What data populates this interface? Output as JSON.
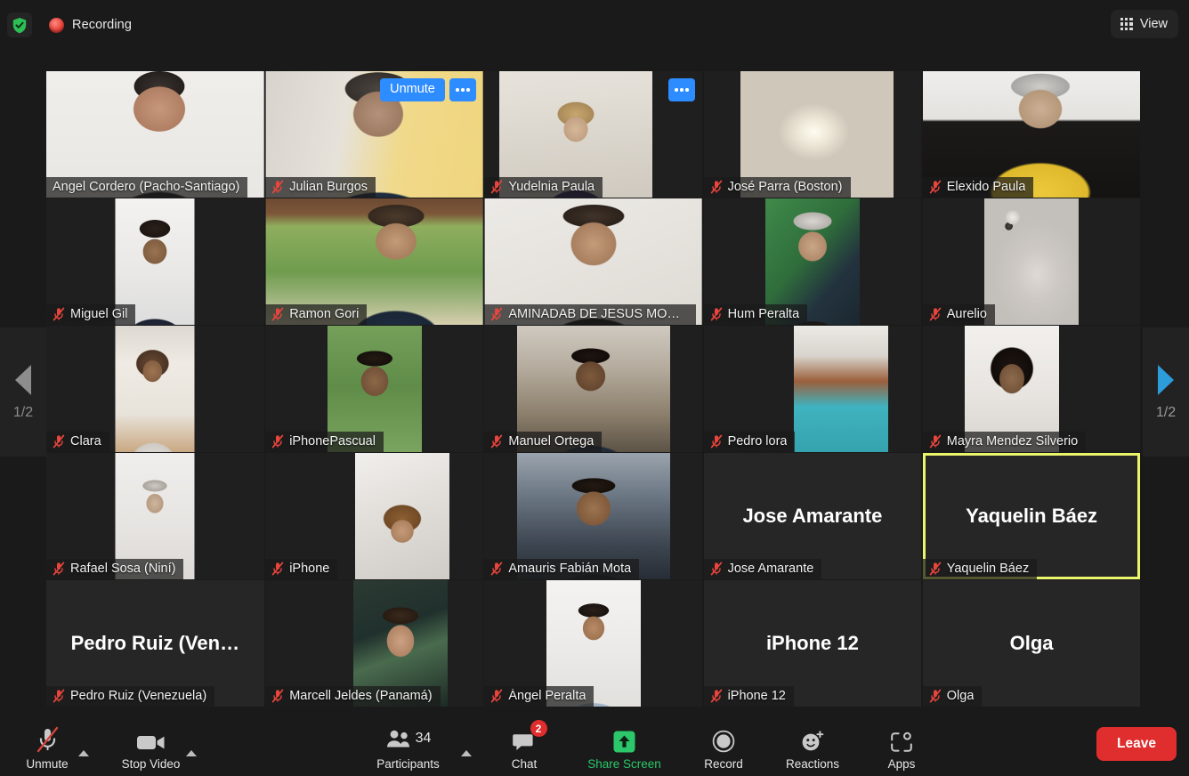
{
  "app": "Zoom Meeting",
  "topbar": {
    "shield_icon": "encryption-shield-icon",
    "recording_icon": "recording-indicator-icon",
    "recording_label": "Recording",
    "view_icon": "grid-view-icon",
    "view_label": "View"
  },
  "gallery": {
    "page_prev_label": "1/2",
    "page_next_label": "1/2",
    "prev_icon": "chevron-left-icon",
    "next_icon": "chevron-right-icon",
    "selected_participant": "Yaquelin Báez",
    "hover_tile": "Julian Burgos",
    "hover_unmute_label": "Unmute",
    "hover_more_label": "…",
    "rows": [
      [
        {
          "name": "Angel Cordero (Pacho-Santiago)",
          "muted": false,
          "video": true
        },
        {
          "name": "Julian Burgos",
          "muted": true,
          "video": true
        },
        {
          "name": "Yudelnia Paula",
          "muted": true,
          "video": true
        },
        {
          "name": "José Parra (Boston)",
          "muted": true,
          "video": true
        },
        {
          "name": "Elexido Paula",
          "muted": true,
          "video": true
        }
      ],
      [
        {
          "name": "Miguel Gil",
          "muted": true,
          "video": true
        },
        {
          "name": "Ramon Gori",
          "muted": true,
          "video": true
        },
        {
          "name": "AMINADAB DE JESUS MON…",
          "muted": true,
          "video": true
        },
        {
          "name": "Hum Peralta",
          "muted": true,
          "video": true
        },
        {
          "name": "Aurelio",
          "muted": true,
          "video": true
        }
      ],
      [
        {
          "name": "Clara",
          "muted": true,
          "video": true
        },
        {
          "name": "iPhonePascual",
          "muted": true,
          "video": true
        },
        {
          "name": "Manuel Ortega",
          "muted": true,
          "video": true
        },
        {
          "name": "Pedro lora",
          "muted": true,
          "video": true
        },
        {
          "name": "Mayra Mendez Silverio",
          "muted": true,
          "video": true
        }
      ],
      [
        {
          "name": "Rafael Sosa (Niní)",
          "muted": true,
          "video": true
        },
        {
          "name": "iPhone",
          "muted": true,
          "video": true
        },
        {
          "name": "Amauris Fabián Mota",
          "muted": true,
          "video": true
        },
        {
          "name": "Jose Amarante",
          "muted": true,
          "video": false,
          "display_name": "Jose Amarante"
        },
        {
          "name": "Yaquelin Báez",
          "muted": true,
          "video": false,
          "display_name": "Yaquelin Báez",
          "selected": true
        }
      ],
      [
        {
          "name": "Pedro Ruiz (Venezuela)",
          "muted": true,
          "video": false,
          "display_name": "Pedro Ruiz (Ven…"
        },
        {
          "name": "Marcell Jeldes (Panamá)",
          "muted": true,
          "video": true
        },
        {
          "name": "Ángel Peralta",
          "muted": true,
          "video": true
        },
        {
          "name": "iPhone 12",
          "muted": true,
          "video": false,
          "display_name": "iPhone 12"
        },
        {
          "name": "Olga",
          "muted": true,
          "video": false,
          "display_name": "Olga"
        }
      ]
    ]
  },
  "toolbar": {
    "mic": {
      "label": "Unmute",
      "icon": "microphone-muted-icon",
      "caret": "chevron-up-icon"
    },
    "video": {
      "label": "Stop Video",
      "icon": "camera-icon",
      "caret": "chevron-up-icon"
    },
    "participants": {
      "label": "Participants",
      "icon": "participants-icon",
      "count": "34",
      "caret": "chevron-up-icon"
    },
    "chat": {
      "label": "Chat",
      "icon": "chat-bubble-icon",
      "badge": "2"
    },
    "share": {
      "label": "Share Screen",
      "icon": "share-screen-up-arrow-icon",
      "color": "#2bc76a"
    },
    "record": {
      "label": "Record",
      "icon": "record-circle-icon"
    },
    "reactions": {
      "label": "Reactions",
      "icon": "smiley-plus-icon"
    },
    "apps": {
      "label": "Apps",
      "icon": "apps-icon"
    },
    "leave": {
      "label": "Leave",
      "color": "#e02d2d"
    }
  }
}
